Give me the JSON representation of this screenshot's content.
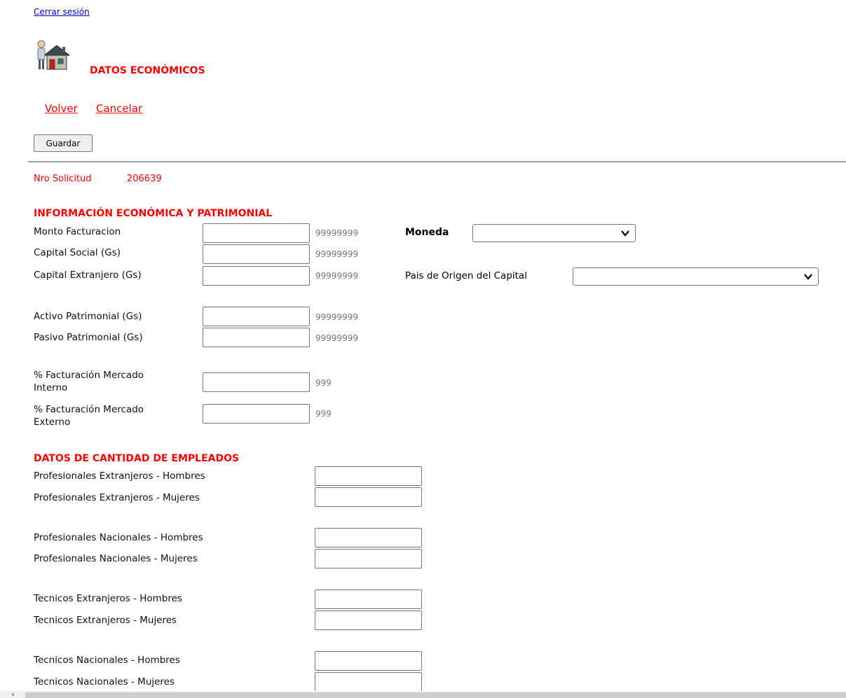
{
  "header": {
    "logout_link": "Cerrar sesión",
    "page_title": "DATOS ECONÓMICOS"
  },
  "nav": {
    "back_link": "Volver",
    "cancel_link": "Cancelar",
    "save_button": "Guardar"
  },
  "request": {
    "label": "Nro Solicitud",
    "value": "206639"
  },
  "economic_section": {
    "title": "INFORMACIÓN ECONÓMICA Y PATRIMONIAL",
    "fields": [
      {
        "label": "Monto Facturacion",
        "value": "",
        "hint": "99999999"
      },
      {
        "label": "Capital Social (Gs)",
        "value": "",
        "hint": "99999999"
      },
      {
        "label": "Capital Extranjero (Gs)",
        "value": "",
        "hint": "99999999"
      },
      {
        "label": "Activo Patrimonial (Gs)",
        "value": "",
        "hint": "99999999"
      },
      {
        "label": "Pasivo Patrimonial (Gs)",
        "value": "",
        "hint": "99999999"
      },
      {
        "label": "% Facturación Mercado Interno",
        "value": "",
        "hint": "999"
      },
      {
        "label": "% Facturación Mercado Externo",
        "value": "",
        "hint": "999"
      }
    ],
    "currency": {
      "label": "Moneda",
      "selected": ""
    },
    "origin_country": {
      "label": "Pais de Origen del Capital",
      "selected": ""
    }
  },
  "employees_section": {
    "title": "DATOS DE CANTIDAD DE EMPLEADOS",
    "fields": [
      {
        "label": "Profesionales Extranjeros - Hombres",
        "value": ""
      },
      {
        "label": "Profesionales Extranjeros - Mujeres",
        "value": ""
      },
      {
        "label": "Profesionales Nacionales - Hombres",
        "value": ""
      },
      {
        "label": "Profesionales Nacionales - Mujeres",
        "value": ""
      },
      {
        "label": "Tecnicos Extranjeros - Hombres",
        "value": ""
      },
      {
        "label": "Tecnicos Extranjeros - Mujeres",
        "value": ""
      },
      {
        "label": "Tecnicos Nacionales - Hombres",
        "value": ""
      },
      {
        "label": "Tecnicos Nacionales - Mujeres",
        "value": ""
      }
    ]
  },
  "colors": {
    "accent": "#ff0000",
    "link": "#0000cc",
    "hint": "#777777"
  },
  "icons": [
    "house-person-icon",
    "chevron-down-icon",
    "scroll-left-arrow-icon"
  ]
}
